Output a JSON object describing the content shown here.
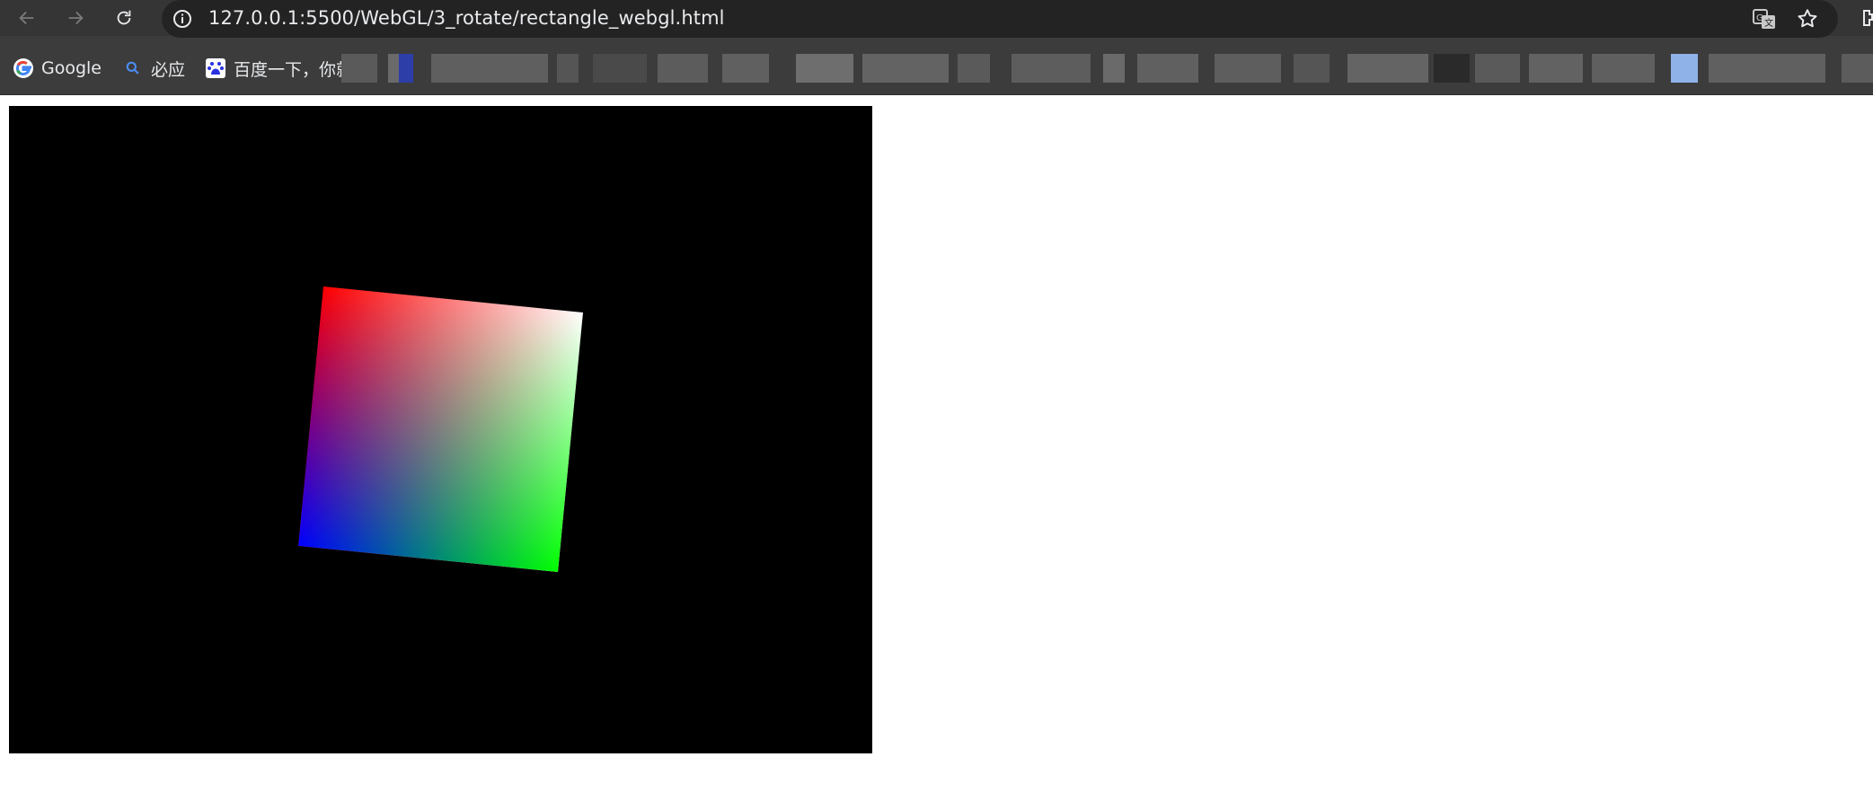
{
  "browser": {
    "url": "127.0.0.1:5500/WebGL/3_rotate/rectangle_webgl.html",
    "nav": {
      "back_icon": "arrow-left-icon",
      "forward_icon": "arrow-right-icon",
      "reload_icon": "reload-icon"
    },
    "omnibox_icons": [
      "info-icon",
      "translate-icon",
      "star-icon"
    ],
    "bookmarks": [
      {
        "label": "Google",
        "icon": "google-g-icon"
      },
      {
        "label": "必应",
        "icon": "search-icon"
      },
      {
        "label": "百度一下，你就",
        "icon": "baidu-paw-icon"
      }
    ],
    "colors": {
      "chrome_bg": "#3c3c3c",
      "omnibox_bg": "#232323",
      "text": "#e8eaed"
    }
  },
  "page": {
    "canvas": {
      "background": "#000000",
      "shape": "rotated-square",
      "corner_colors": {
        "top_left": "#ff0000",
        "top_right": "#ffffff",
        "bottom_right": "#00ff00",
        "bottom_left": "#0000ff"
      }
    }
  }
}
